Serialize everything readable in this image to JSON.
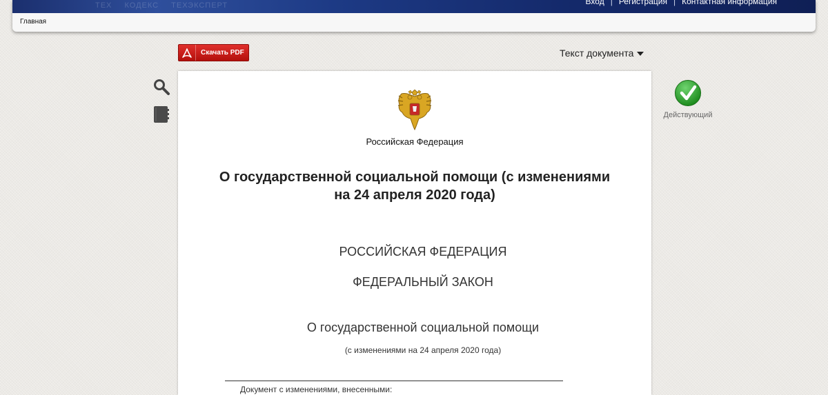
{
  "header": {
    "banner_logos": [
      "ТЕХ",
      "КОДЕКС",
      "ТЕХЭКСПЕРТ"
    ],
    "links": {
      "login": "Вход",
      "register": "Регистрация",
      "contacts": "Контактная информация"
    },
    "separator": "|",
    "breadcrumb": "Главная"
  },
  "toolbar": {
    "pdf_label": "Скачать PDF",
    "doc_view": "Текст документа",
    "icons": [
      "search-icon",
      "bookmark-icon"
    ]
  },
  "status": {
    "label": "Действующий",
    "color": "#2fa82f",
    "icon": "checkmark-icon"
  },
  "document": {
    "country_small": "Российская Федерация",
    "title_line1": "О государственной социальной помощи (с изменениями",
    "title_line2": "на 24 апреля 2020 года)",
    "country": "РОССИЙСКАЯ ФЕДЕРАЦИЯ",
    "law_type": "ФЕДЕРАЛЬНЫЙ ЗАКОН",
    "law_name": "О государственной социальной помощи",
    "amendment": "(с изменениями на 24 апреля 2020 года)",
    "partial_text": "Документ с изменениями, внесенными:"
  },
  "colors": {
    "pdf_button": "#c81e1a",
    "banner": "#1b2f6e",
    "background": "#eceae6"
  }
}
